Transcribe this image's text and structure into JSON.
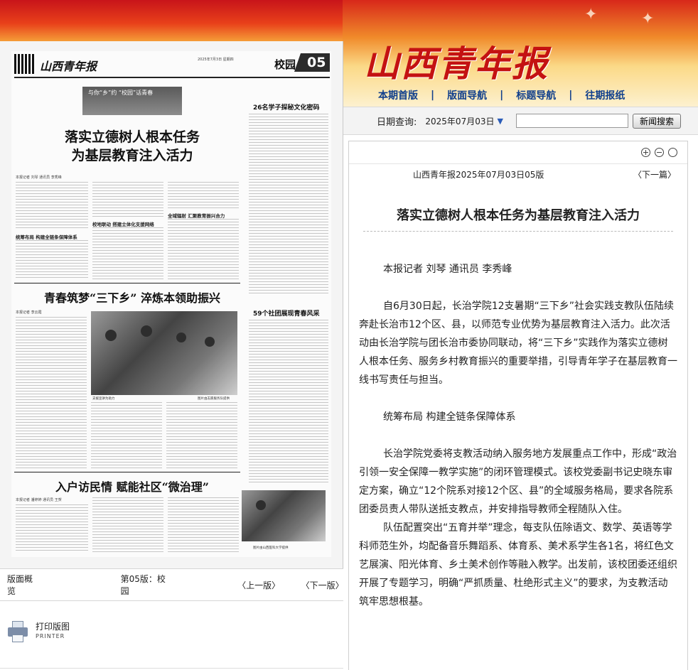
{
  "masthead": {
    "logo_text": "山西青年报"
  },
  "top_nav": {
    "items": [
      "本期首版",
      "版面导航",
      "标题导航",
      "往期报纸"
    ],
    "separator": "|"
  },
  "date_query": {
    "label": "日期查询:",
    "value": "2025年07月03日",
    "input_value": "",
    "search_button": "新闻搜索"
  },
  "article": {
    "source": "山西青年报2025年07月03日05版",
    "next_label": "〈下一篇〉",
    "title": "落实立德树人根本任务为基层教育注入活力",
    "paragraphs": [
      "本报记者 刘琴 通讯员 李秀峰",
      "自6月30日起，长治学院12支暑期“三下乡”社会实践支教队伍陆续奔赴长治市12个区、县，以师范专业优势为基层教育注入活力。此次活动由长治学院与团长治市委协同联动，将“三下乡”实践作为落实立德树人根本任务、服务乡村教育振兴的重要举措，引导青年学子在基层教育一线书写责任与担当。",
      "统筹布局 构建全链条保障体系",
      "长治学院党委将支教活动纳入服务地方发展重点工作中，形成“政治引领一安全保障一教学实施”的闭环管理模式。该校党委副书记史晓东审定方案，确立“12个院系对接12个区、县”的全域服务格局，要求各院系团委员责人带队送抵支教点，并安排指导教师全程随队入住。",
      "队伍配置突出“五育并举”理念，每支队伍除语文、数学、英语等学科师范生外，均配备音乐舞蹈系、体育系、美术系学生各1名，将红色文艺展演、阳光体育、乡土美术创作等融入教学。出发前，该校团委还组织开展了专题学习，明确“严抓质量、杜绝形式主义”的要求，为支教活动筑牢思想根基。"
    ]
  },
  "newspaper": {
    "masthead": "山西青年报",
    "header_info": "2025年7月3日 星期四",
    "section": "校园",
    "page_number": "05",
    "badge_text": "与你“乡”约 “校园”话青春",
    "title1": "落实立德树人根本任务\n为基层教育注入活力",
    "byline1": "本报记者 刘琴 通讯员 李秀峰",
    "sub1": "统筹布局 构建全链条保障体系",
    "sub2": "校地联动 搭建立体化支援网络",
    "sub3": "全域辐射 汇聚教育振兴合力",
    "title2": "青春筑梦“三下乡” 淬炼本领助振兴",
    "byline2": "本报记者 李云霞",
    "title3": "入户访民情 赋能社区“微治理”",
    "byline3": "本报记者 潘婷婷 通讯员 王贺",
    "side_title1": "26名学子探秘文化密码",
    "side_title2": "59个社团展现青春风采",
    "caption1": "支援宣讲为助力",
    "caption2": "图片由志愿服务队提供",
    "caption3": "图片由山西医科大学提供"
  },
  "paper_nav": {
    "overview": "版面概览",
    "current": "第05版：校园",
    "prev": "〈上一版〉",
    "next": "〈下一版〉"
  },
  "printer": {
    "label": "打印版图",
    "label_en": "PRINTER",
    "icon": "printer-icon"
  }
}
